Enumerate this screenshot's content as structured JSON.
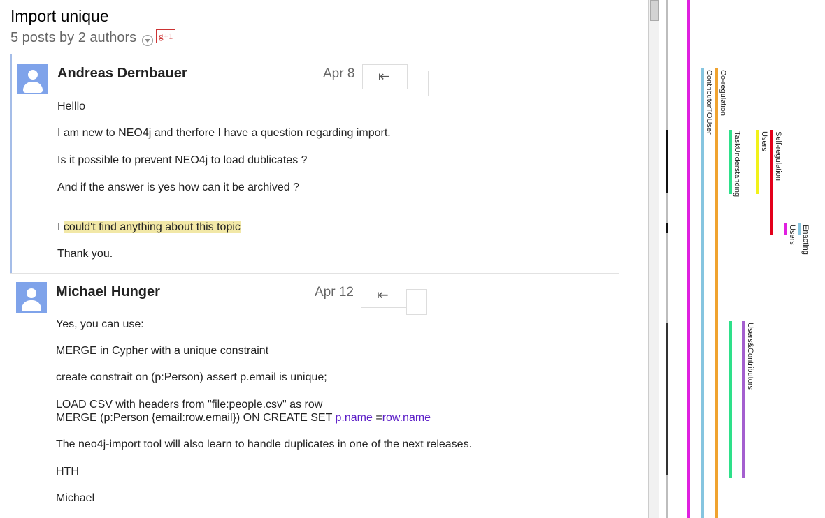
{
  "thread": {
    "title": "Import unique",
    "subtitle": "5 posts by 2 authors",
    "gplus_label": "g+1",
    "posts": [
      {
        "author": "Andreas Dernbauer",
        "date": "Apr 8",
        "lines": [
          "Helllo",
          "I am new to NEO4j and therfore I have a question regarding import.",
          "Is it possible to prevent NEO4j to load dublicates ?",
          "And if the answer is yes how can it be archived ?",
          "I ",
          "could't  find anything about this topic",
          "Thank you."
        ]
      },
      {
        "author": "Michael Hunger",
        "date": "Apr 12",
        "lines": [
          "Yes, you can use:",
          "MERGE in Cypher with a unique constraint",
          "create constrait on (p:Person) assert p.email is unique;",
          "LOAD CSV with headers from \"file:people.csv\" as row",
          "MERGE (p:Person {email:row.email}) ON CREATE SET ",
          "p.name",
          " =",
          "row.name",
          "The neo4j-import tool will also learn to handle duplicates in one of the next releases.",
          "HTH",
          "Michael"
        ]
      }
    ]
  },
  "icons": {
    "reply": "reply-all-icon",
    "avatar": "default-avatar-icon",
    "dropdown": "chevron-down-icon"
  },
  "colors": {
    "avatar": "#7fa3ea",
    "highlight": "#f2e8a7",
    "link": "#5c1ec7",
    "post_accent": "#a5bde8"
  },
  "timeline_panel": {
    "labels": {
      "contributor_to_user": "ContributorTOUser",
      "co_regulation": "Co-regulation",
      "task_understanding": "TaskUnderstanding",
      "users_1": "Users",
      "self_regulation": "Self-regulation",
      "users_2": "Users",
      "enacting": "Enacting",
      "users_contributors": "Users&Contributors"
    },
    "colors": {
      "magenta": "#e020e0",
      "lightblue": "#86c5e0",
      "orange": "#f0a330",
      "green": "#2ee08a",
      "yellow": "#f2f21a",
      "red": "#e3001b",
      "purple": "#a45fcf"
    }
  }
}
